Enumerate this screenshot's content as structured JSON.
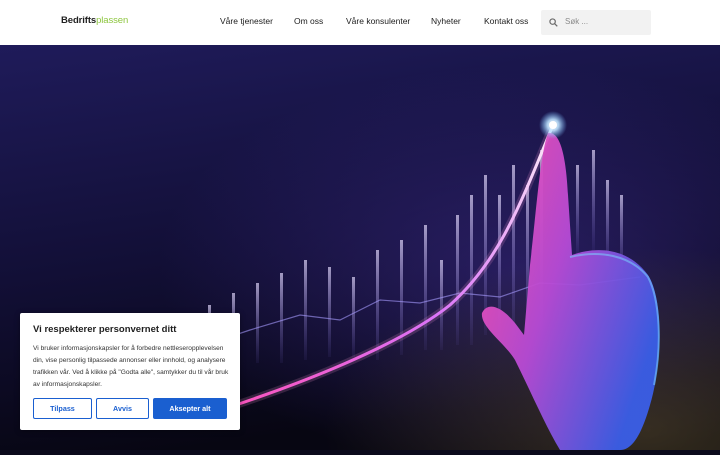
{
  "header": {
    "logo": {
      "part1": "Bedrifts",
      "part2": "plassen"
    },
    "nav": [
      {
        "label": "Våre tjenester"
      },
      {
        "label": "Om oss"
      },
      {
        "label": "Våre konsulenter"
      },
      {
        "label": "Nyheter"
      },
      {
        "label": "Kontakt oss"
      }
    ],
    "search": {
      "placeholder": "Søk ...",
      "icon": "search-icon"
    }
  },
  "hero": {
    "image": "glowing-growth-chart-with-pointing-hand"
  },
  "cookie_banner": {
    "title": "Vi respekterer personvernet ditt",
    "text": "Vi bruker informasjonskapsler for å forbedre nettleseropplevelsen din, vise personlig tilpassede annonser eller innhold, og analysere trafikken vår. Ved å klikke på \"Godta alle\", samtykker du til vår bruk av informasjonskapsler.",
    "buttons": {
      "customize": "Tilpass",
      "reject": "Avvis",
      "accept": "Aksepter alt"
    }
  },
  "colors": {
    "accent": "#1a5fd0",
    "logo_green": "#8dc63f"
  }
}
